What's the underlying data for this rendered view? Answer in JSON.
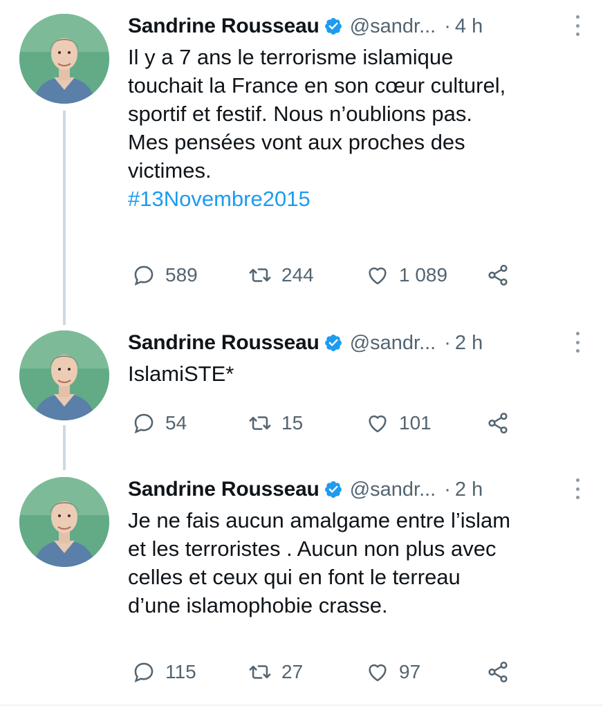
{
  "colors": {
    "link": "#1d9bf0",
    "secondary_text": "#536471",
    "verified_badge": "#1d9bf0",
    "thread_line": "#cfd9de"
  },
  "icons": {
    "reply": "speech-bubble",
    "retweet": "retweet-arrows",
    "like": "heart",
    "share": "share-nodes",
    "verified": "verified-badge",
    "more": "vertical-ellipsis"
  },
  "tweets": [
    {
      "author_name": "Sandrine Rousseau",
      "handle": "@sandr...",
      "separator": "·",
      "time": "4 h",
      "text_lines": [
        "Il y a 7 ans le terrorisme islamique",
        "touchait la France en son cœur culturel,",
        "sportif et festif. Nous n’oublions pas.",
        "Mes pensées vont aux proches des",
        "victimes."
      ],
      "hashtag": "#13Novembre2015",
      "replies": "589",
      "retweets": "244",
      "likes": "1 089"
    },
    {
      "author_name": "Sandrine Rousseau",
      "handle": "@sandr...",
      "separator": "·",
      "time": "2 h",
      "text_lines": [
        "IslamiSTE*"
      ],
      "replies": "54",
      "retweets": "15",
      "likes": "101"
    },
    {
      "author_name": "Sandrine Rousseau",
      "handle": "@sandr...",
      "separator": "·",
      "time": "2 h",
      "text_lines": [
        "Je ne fais aucun amalgame entre l’islam",
        "et les terroristes . Aucun non plus avec",
        "celles et ceux qui en font le terreau",
        "d’une islamophobie crasse."
      ],
      "replies": "115",
      "retweets": "27",
      "likes": "97"
    }
  ]
}
